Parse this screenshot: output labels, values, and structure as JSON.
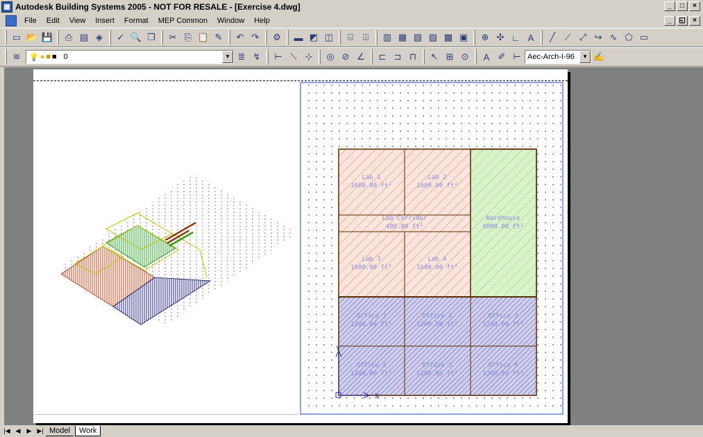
{
  "window": {
    "title": "Autodesk Building Systems 2005 - NOT FOR RESALE - [Exercise 4.dwg]",
    "controls": [
      "_",
      "□",
      "×"
    ],
    "doc_controls": [
      "_",
      "◱",
      "×"
    ]
  },
  "menu": {
    "items": [
      "File",
      "Edit",
      "View",
      "Insert",
      "Format",
      "MEP Common",
      "Window",
      "Help"
    ]
  },
  "layer": {
    "current": "0"
  },
  "dimstyle": {
    "current": "Aec-Arch-I-96"
  },
  "drawing": {
    "spaces": [
      {
        "name": "Lab 1",
        "area": "1600.00 ft²"
      },
      {
        "name": "Lab 2",
        "area": "1600.00 ft²"
      },
      {
        "name": "Lab Corridor",
        "area": "400.00 ft²"
      },
      {
        "name": "Lab 3",
        "area": "1600.00 ft²"
      },
      {
        "name": "Lab 4",
        "area": "1600.00 ft²"
      },
      {
        "name": "Warehouse",
        "area": "4800.00 ft²"
      },
      {
        "name": "Office 1",
        "area": "1200.00 ft²"
      },
      {
        "name": "Office 2",
        "area": "1200.00 ft²"
      },
      {
        "name": "Office 3",
        "area": "1200.00 ft²"
      },
      {
        "name": "Office 4",
        "area": "1200.00 ft²"
      },
      {
        "name": "Office 5",
        "area": "1200.00 ft²"
      },
      {
        "name": "Office 6",
        "area": "1200.00 ft²"
      }
    ],
    "ucs": {
      "x": "X",
      "y": "Y"
    },
    "colors": {
      "lab": "#e86a3a",
      "warehouse": "#6bcf3a",
      "office": "#2a2aa0",
      "label": "#8a8ae0",
      "outline": "#5a2a00",
      "viewport": "#8ea0e8"
    }
  },
  "tabs": {
    "nav": [
      "|◀",
      "◀",
      "▶",
      "▶|"
    ],
    "model": "Model",
    "work": "Work"
  }
}
